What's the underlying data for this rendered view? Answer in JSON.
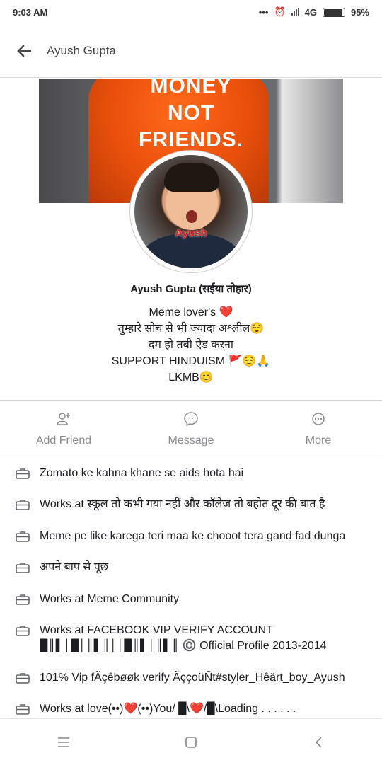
{
  "status_bar": {
    "time": "9:03 AM",
    "network": "4G",
    "battery": "95%"
  },
  "header": {
    "title": "Ayush Gupta"
  },
  "cover": {
    "text": [
      "MONEY",
      "NOT",
      "FRIENDS."
    ]
  },
  "avatar": {
    "label": "Ayush"
  },
  "profile": {
    "name": "Ayush Gupta (सईया तोहार)"
  },
  "bio": [
    "Meme lover's ❤️",
    "तुम्हारे सोच से भी ज्यादा अश्लील😌",
    "दम हो तबी ऐड करना",
    "SUPPORT HINDUISM 🚩😌🙏",
    "LKMB😊"
  ],
  "actions": {
    "add_friend": "Add Friend",
    "message": "Message",
    "more": "More"
  },
  "details": [
    "Zomato ke kahna khane se aids hota hai",
    "Works at स्कूल तो कभी गया नहीं और कॉलेज तो बहोत दूर की बात है",
    "Meme pe like karega teri maa ke chooot tera gand fad dunga",
    "अपने बाप से पूछ",
    "Works at Meme Community",
    "Works at FACEBOOK VIP VERIFY ACCOUNT █║▌│█│║▌║││█║▌│║▌║ ©️ Official Profile 2013-2014",
    "101% Vip fÃçêbøøk verify ÃççoüÑt#styler_Hêärt_boy_Ayush",
    "Works at love(••)❤️(••)You/ █\\❤️/█\\Loading . . . . . ."
  ]
}
